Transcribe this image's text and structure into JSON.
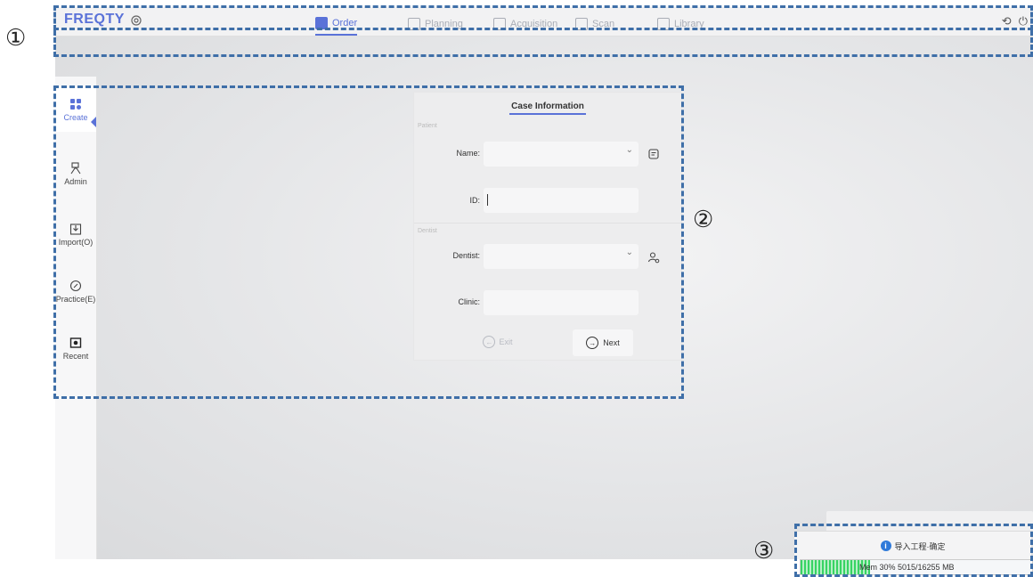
{
  "app": {
    "brand": "FREQTY",
    "top_tabs": [
      {
        "label": "Order",
        "active": true
      },
      {
        "label": "Planning",
        "active": false
      },
      {
        "label": "Acquisition",
        "active": false
      },
      {
        "label": "Scan",
        "active": false
      },
      {
        "label": "Library",
        "active": false
      }
    ]
  },
  "sidebar": {
    "items": [
      {
        "label": "Create",
        "icon": "grid-icon",
        "active": true
      },
      {
        "label": "Admin",
        "icon": "admin-icon",
        "active": false
      },
      {
        "label": "Import(O)",
        "icon": "import-icon",
        "active": false
      },
      {
        "label": "Practice(E)",
        "icon": "practice-icon",
        "active": false
      },
      {
        "label": "Recent",
        "icon": "recent-icon",
        "active": false
      }
    ]
  },
  "case_form": {
    "title": "Case Information",
    "patient_section": "Patient",
    "name_label": "Name:",
    "name_value": "",
    "id_label": "ID:",
    "id_value": "",
    "dentist_section": "Dentist",
    "dentist_label": "Dentist:",
    "dentist_value": "",
    "clinic_label": "Clinic:",
    "clinic_value": "",
    "exit_label": "Exit",
    "next_label": "Next"
  },
  "notice": {
    "text": "导入工程·确定",
    "icon": "info-icon"
  },
  "memory": {
    "text": "Mem 30% 5015/16255 MB",
    "percent": 30
  },
  "annotations": [
    "①",
    "②",
    "③"
  ],
  "colors": {
    "accent": "#5a72d8",
    "annotation_dash": "#3f6fa8",
    "mem_green": "#37d463",
    "info_blue": "#2f7ad9"
  }
}
